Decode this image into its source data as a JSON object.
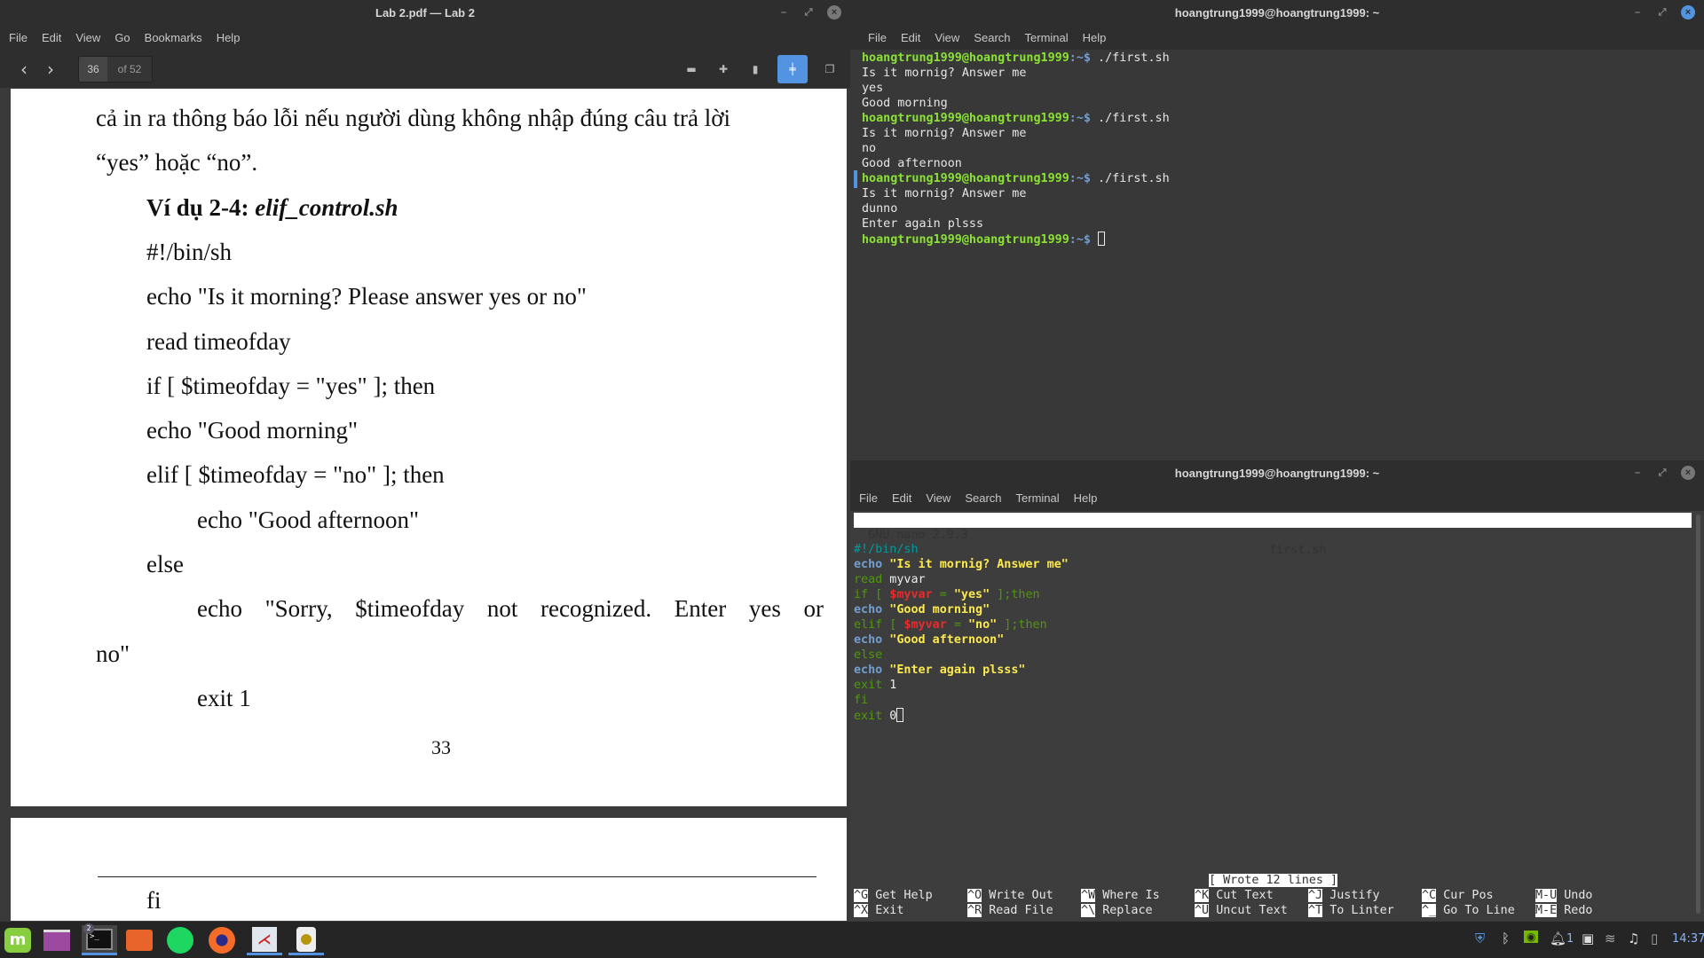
{
  "pdf_window": {
    "title": "Lab 2.pdf — Lab 2",
    "menu": [
      "File",
      "Edit",
      "View",
      "Go",
      "Bookmarks",
      "Help"
    ],
    "current_page": "36",
    "total_pages": "of 52",
    "page_lines": [
      {
        "text": "cả in ra thông báo lỗi nếu người dùng không nhập đúng câu trả lời",
        "indent": 0
      },
      {
        "text": "“yes” hoặc “no”.",
        "indent": 0
      },
      {
        "text": "Ví dụ 2-4: ",
        "italic_part": "elif_control.sh",
        "indent": 1,
        "bold": true
      },
      {
        "text": "#!/bin/sh",
        "indent": 1
      },
      {
        "text": "echo \"Is it morning? Please answer yes or no\"",
        "indent": 1
      },
      {
        "text": "read timeofday",
        "indent": 1
      },
      {
        "text": "if [ $timeofday = \"yes\" ]; then",
        "indent": 1
      },
      {
        "text": "echo \"Good morning\"",
        "indent": 1
      },
      {
        "text": "elif [ $timeofday = \"no\" ]; then",
        "indent": 1
      },
      {
        "text": "echo \"Good afternoon\"",
        "indent": 2
      },
      {
        "text": "else",
        "indent": 1
      },
      {
        "text": "echo \"Sorry, $timeofday not recognized. Enter yes or",
        "indent": 2,
        "justify": true
      },
      {
        "text": "no\"",
        "indent": 0
      },
      {
        "text": "exit 1",
        "indent": 2
      }
    ],
    "page_number": "33",
    "next_page_text": "fi"
  },
  "top_terminal": {
    "title": "hoangtrung1999@hoangtrung1999: ~",
    "menu": [
      "File",
      "Edit",
      "View",
      "Search",
      "Terminal",
      "Help"
    ],
    "prompt_user": "hoangtrung1999@hoangtrung1999",
    "prompt_path": ":~$",
    "lines": [
      {
        "prompt": true,
        "text": " ./first.sh"
      },
      {
        "text": "Is it mornig? Answer me"
      },
      {
        "text": "yes"
      },
      {
        "text": "Good morning"
      },
      {
        "prompt": true,
        "text": " ./first.sh"
      },
      {
        "text": "Is it mornig? Answer me"
      },
      {
        "text": "no"
      },
      {
        "text": "Good afternoon"
      },
      {
        "prompt": true,
        "text": " ./first.sh"
      },
      {
        "text": "Is it mornig? Answer me"
      },
      {
        "text": "dunno"
      },
      {
        "text": "Enter again plsss"
      },
      {
        "prompt": true,
        "text": " ",
        "cursor": true
      }
    ]
  },
  "bottom_terminal": {
    "title": "hoangtrung1999@hoangtrung1999: ~",
    "menu": [
      "File",
      "Edit",
      "View",
      "Search",
      "Terminal",
      "Help"
    ],
    "nano_version": "GNU nano 2.9.3",
    "filename": "first.sh",
    "code": [
      [
        {
          "t": "#!/bin/sh",
          "c": "comment"
        }
      ],
      [
        {
          "t": "echo",
          "c": "cmd"
        },
        {
          "t": " \"Is it mornig? Answer me\"",
          "c": "str"
        }
      ],
      [
        {
          "t": "read",
          "c": "kw"
        },
        {
          "t": " myvar",
          "c": "txt"
        }
      ],
      [
        {
          "t": "if [ ",
          "c": "kw"
        },
        {
          "t": "$myvar",
          "c": "var"
        },
        {
          "t": " = ",
          "c": "kw"
        },
        {
          "t": "\"yes\"",
          "c": "str"
        },
        {
          "t": " ];then",
          "c": "kw"
        }
      ],
      [
        {
          "t": "echo",
          "c": "cmd"
        },
        {
          "t": " \"Good morning\"",
          "c": "str"
        }
      ],
      [
        {
          "t": "elif [ ",
          "c": "kw"
        },
        {
          "t": "$myvar",
          "c": "var"
        },
        {
          "t": " = ",
          "c": "kw"
        },
        {
          "t": "\"no\"",
          "c": "str"
        },
        {
          "t": " ];then",
          "c": "kw"
        }
      ],
      [
        {
          "t": "echo",
          "c": "cmd"
        },
        {
          "t": " \"Good afternoon\"",
          "c": "str"
        }
      ],
      [
        {
          "t": "else",
          "c": "kw"
        }
      ],
      [
        {
          "t": "echo",
          "c": "cmd"
        },
        {
          "t": " \"Enter again plsss\"",
          "c": "str"
        }
      ],
      [
        {
          "t": "exit",
          "c": "kw"
        },
        {
          "t": " 1",
          "c": "txt"
        }
      ],
      [
        {
          "t": "fi",
          "c": "kw"
        }
      ],
      [
        {
          "t": "exit",
          "c": "kw"
        },
        {
          "t": " 0",
          "c": "txt"
        }
      ]
    ],
    "status": "[ Wrote 12 lines ]",
    "shortcuts": [
      [
        {
          "k": "^G",
          "l": "Get Help"
        },
        {
          "k": "^X",
          "l": "Exit"
        }
      ],
      [
        {
          "k": "^O",
          "l": "Write Out"
        },
        {
          "k": "^R",
          "l": "Read File"
        }
      ],
      [
        {
          "k": "^W",
          "l": "Where Is"
        },
        {
          "k": "^\\",
          "l": "Replace"
        }
      ],
      [
        {
          "k": "^K",
          "l": "Cut Text"
        },
        {
          "k": "^U",
          "l": "Uncut Text"
        }
      ],
      [
        {
          "k": "^J",
          "l": "Justify"
        },
        {
          "k": "^T",
          "l": "To Linter"
        }
      ],
      [
        {
          "k": "^C",
          "l": "Cur Pos"
        },
        {
          "k": "^_",
          "l": "Go To Line"
        }
      ],
      [
        {
          "k": "M-U",
          "l": "Undo"
        },
        {
          "k": "M-E",
          "l": "Redo"
        }
      ]
    ]
  },
  "taskbar": {
    "apps": [
      "mint-menu",
      "show-desktop",
      "terminal",
      "files",
      "spotify",
      "firefox",
      "pdf-reader",
      "music-player"
    ],
    "terminal_badge": "2",
    "notifications_count": "1",
    "clock": "14:37"
  }
}
